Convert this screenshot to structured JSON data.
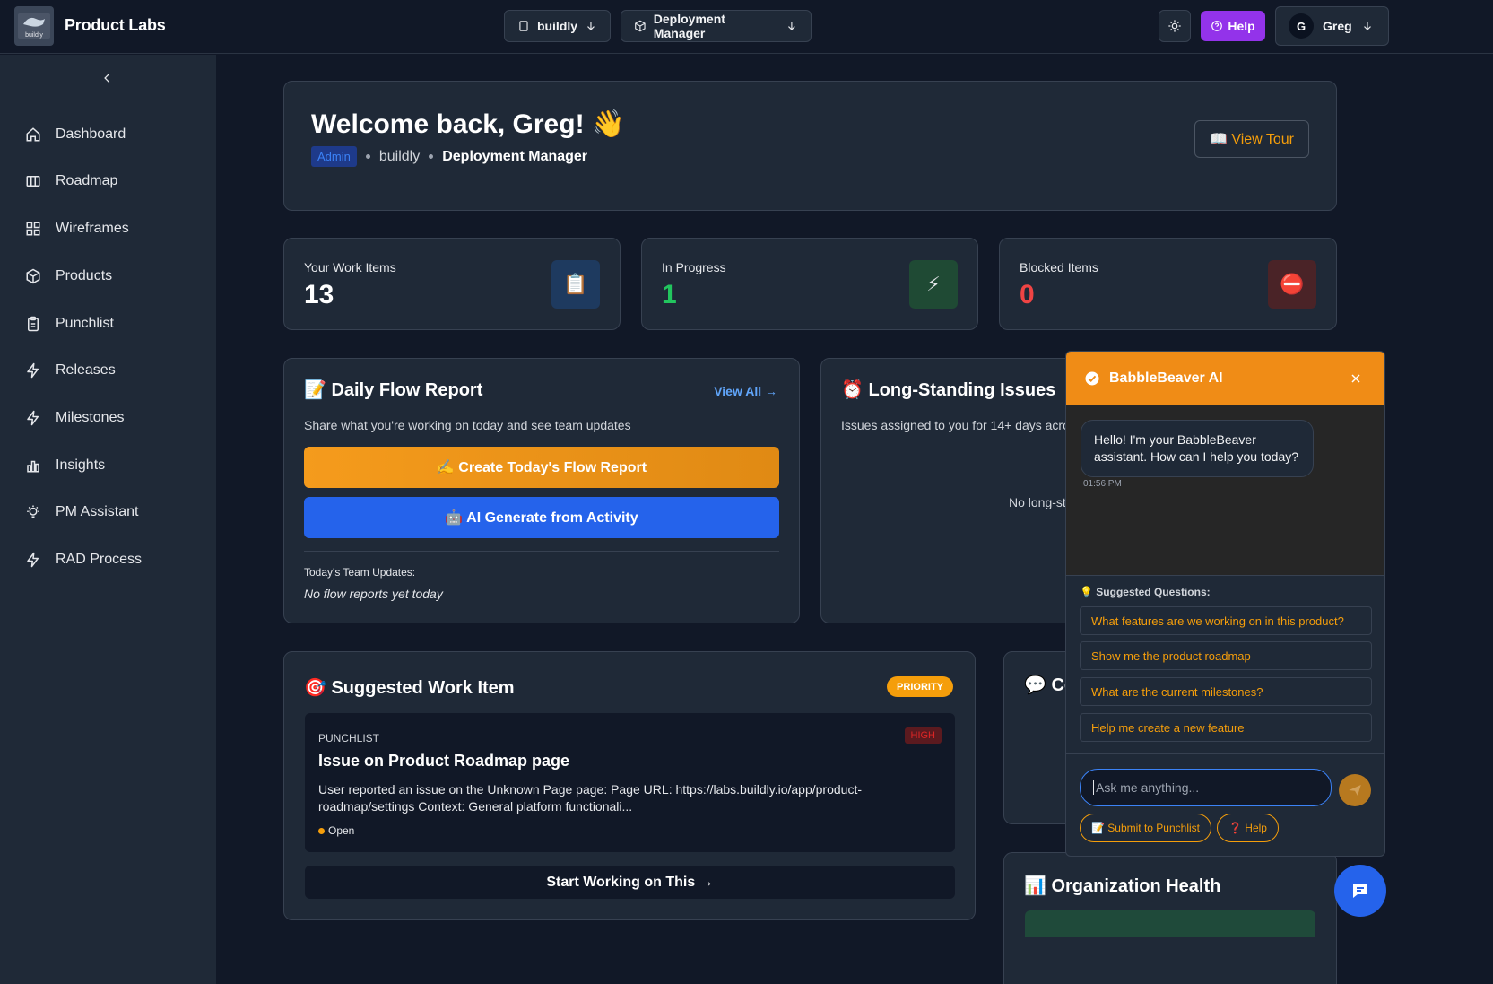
{
  "app": {
    "name": "Product Labs",
    "logo_text": "buildly"
  },
  "header": {
    "org_select": "buildly",
    "product_select": "Deployment Manager",
    "help_label": "Help",
    "user_initial": "G",
    "user_name": "Greg"
  },
  "sidebar": {
    "items": [
      {
        "label": "Dashboard",
        "icon": "home-icon"
      },
      {
        "label": "Roadmap",
        "icon": "columns-icon"
      },
      {
        "label": "Wireframes",
        "icon": "grid-icon"
      },
      {
        "label": "Products",
        "icon": "box-icon"
      },
      {
        "label": "Punchlist",
        "icon": "clipboard-icon"
      },
      {
        "label": "Releases",
        "icon": "bolt-icon"
      },
      {
        "label": "Milestones",
        "icon": "bolt-icon"
      },
      {
        "label": "Insights",
        "icon": "bar-chart-icon"
      },
      {
        "label": "PM Assistant",
        "icon": "lightbulb-icon"
      },
      {
        "label": "RAD Process",
        "icon": "bolt-icon"
      }
    ]
  },
  "welcome": {
    "title": "Welcome back, Greg! 👋",
    "role_badge": "Admin",
    "org": "buildly",
    "product": "Deployment Manager",
    "tour_label": "📖 View Tour"
  },
  "stats": [
    {
      "label": "Your Work Items",
      "value": "13",
      "icon": "📋",
      "color": "#ffffff",
      "icon_bg": "#1e3a5f"
    },
    {
      "label": "In Progress",
      "value": "1",
      "icon": "⚡",
      "color": "#22c55e",
      "icon_bg": "#1f4a34"
    },
    {
      "label": "Blocked Items",
      "value": "0",
      "icon": "⛔",
      "color": "#ef4444",
      "icon_bg": "#4a2327"
    }
  ],
  "daily_flow": {
    "title": "📝 Daily Flow Report",
    "view_all": "View All →",
    "subtitle": "Share what you're working on today and see team updates",
    "create_btn": "✍️ Create Today's Flow Report",
    "ai_btn": "🤖 AI Generate from Activity",
    "team_updates_label": "Today's Team Updates:",
    "team_updates_empty": "No flow reports yet today"
  },
  "long_standing": {
    "title": "⏰ Long-Standing Issues",
    "subtitle": "Issues assigned to you for 14+ days acro",
    "empty": "No long-st"
  },
  "suggested": {
    "title": "🎯 Suggested Work Item",
    "badge": "PRIORITY",
    "category": "PUNCHLIST",
    "priority": "HIGH",
    "item_title": "Issue on Product Roadmap page",
    "description": "User reported an issue on the Unknown Page page: Page URL: https://labs.buildly.io/app/product-roadmap/settings Context: General platform functionali...",
    "status": "Open",
    "start_btn": "Start Working on This →"
  },
  "comments_card": {
    "title": "💬 Co"
  },
  "org_health": {
    "title": "📊 Organization Health"
  },
  "chat": {
    "title": "BabbleBeaver AI",
    "greeting": "Hello! I'm your BabbleBeaver assistant. How can I help you today?",
    "time": "01:56 PM",
    "suggested_label": "💡 Suggested Questions:",
    "questions": [
      "What features are we working on in this product?",
      "Show me the product roadmap",
      "What are the current milestones?",
      "Help me create a new feature"
    ],
    "input_placeholder": "Ask me anything...",
    "submit_chip": "📝 Submit to Punchlist",
    "help_chip": "❓ Help"
  }
}
